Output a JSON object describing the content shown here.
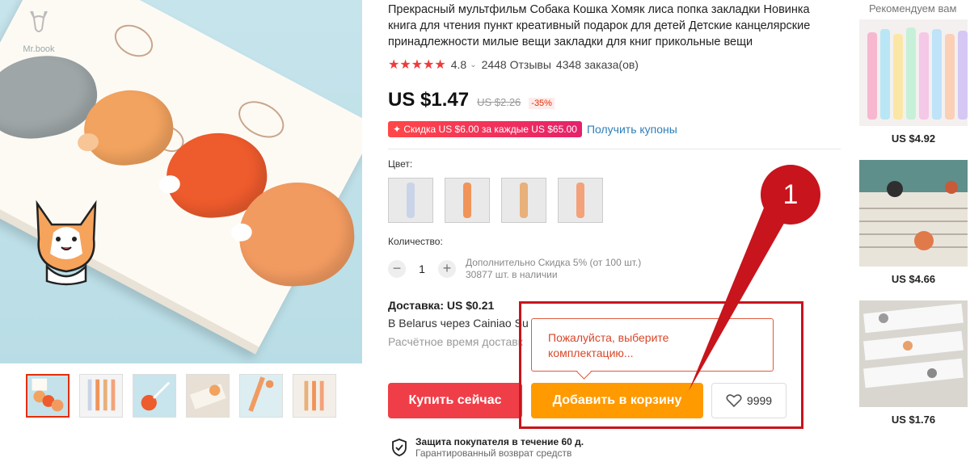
{
  "gallery": {
    "brand": "Mr.book",
    "thumbnails": [
      {
        "name": "thumb-1",
        "active": true
      },
      {
        "name": "thumb-2",
        "active": false
      },
      {
        "name": "thumb-3",
        "active": false
      },
      {
        "name": "thumb-4",
        "active": false
      },
      {
        "name": "thumb-5",
        "active": false
      },
      {
        "name": "thumb-6",
        "active": false
      }
    ]
  },
  "product": {
    "title": "Прекрасный мультфильм Собака Кошка Хомяк лиса попка закладки Новинка книга для чтения пункт креативный подарок для детей Детские канцелярские принадлежности милые вещи закладки для книг прикольные вещи",
    "rating": "4.8",
    "reviews": "2448 Отзывы",
    "orders": "4348 заказа(ов)",
    "price": "US $1.47",
    "old_price": "US $2.26",
    "discount": "-35%",
    "coupon": "✦ Скидка US $6.00 за каждые US $65.00",
    "coupon_link": "Получить купоны",
    "color_label": "Цвет:",
    "swatch_colors": [
      "#c9d4e8",
      "#f0945a",
      "#e8b07a",
      "#f3a27a"
    ],
    "qty_label": "Количество:",
    "qty_minus": "−",
    "qty_value": "1",
    "qty_plus": "+",
    "qty_discount": "Дополнительно Скидка 5% (от 100 шт.)",
    "qty_stock": "30877 шт. в наличии",
    "shipping_title": "Доставка: US $0.21",
    "shipping_line": "В Belarus через Cainiao Su",
    "shipping_eta": "Расчётное время доставк"
  },
  "actions": {
    "buy_now": "Купить сейчас",
    "add_to_cart": "Добавить в корзину",
    "wishlist_count": "9999"
  },
  "tooltip": {
    "message": "Пожалуйста, выберите комплектацию..."
  },
  "annotation": {
    "number": "1",
    "color": "#c8141c"
  },
  "guarantee": {
    "title": "Защита покупателя в течение 60 д.",
    "subtitle": "Гарантированный возврат средств"
  },
  "recommendations": {
    "title": "Рекомендуем вам",
    "items": [
      {
        "price": "US $4.92"
      },
      {
        "price": "US $4.66"
      },
      {
        "price": "US $1.76"
      }
    ]
  },
  "colors": {
    "accent": "#e62e04",
    "buy": "#f03e48",
    "cart": "#ff9a00",
    "link": "#2e7fb8"
  }
}
